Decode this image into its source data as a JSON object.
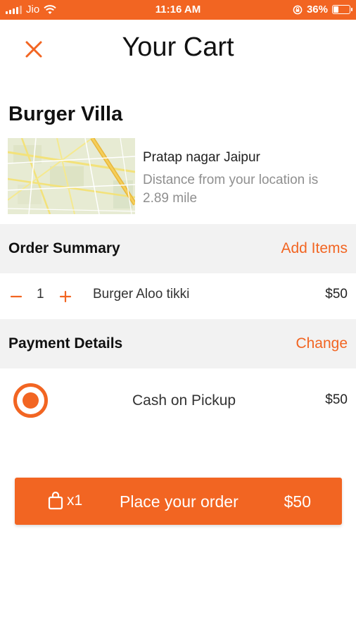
{
  "status_bar": {
    "carrier": "Jio",
    "time": "11:16 AM",
    "battery_percent": "36%",
    "battery_level": 0.36,
    "icons": [
      "signal-icon",
      "wifi-icon",
      "rotation-lock-icon",
      "battery-icon"
    ]
  },
  "header": {
    "title": "Your Cart",
    "close_icon": "close-icon"
  },
  "restaurant": {
    "name": "Burger Villa",
    "location": "Pratap nagar Jaipur",
    "distance": "Distance from your location is 2.89 mile",
    "map_icon": "map-thumbnail"
  },
  "order_summary": {
    "title": "Order Summary",
    "action": "Add Items",
    "items": [
      {
        "quantity": "1",
        "name": "Burger Aloo tikki",
        "price": "$50"
      }
    ]
  },
  "payment": {
    "title": "Payment Details",
    "action": "Change",
    "method": "Cash on Pickup",
    "amount": "$50",
    "selected": true
  },
  "place_order": {
    "bag_count": "x1",
    "label": "Place your order",
    "total": "$50",
    "bag_icon": "shopping-bag-icon"
  },
  "colors": {
    "accent": "#f26522",
    "section_bg": "#f2f2f2",
    "muted_text": "#8f8f8f"
  }
}
